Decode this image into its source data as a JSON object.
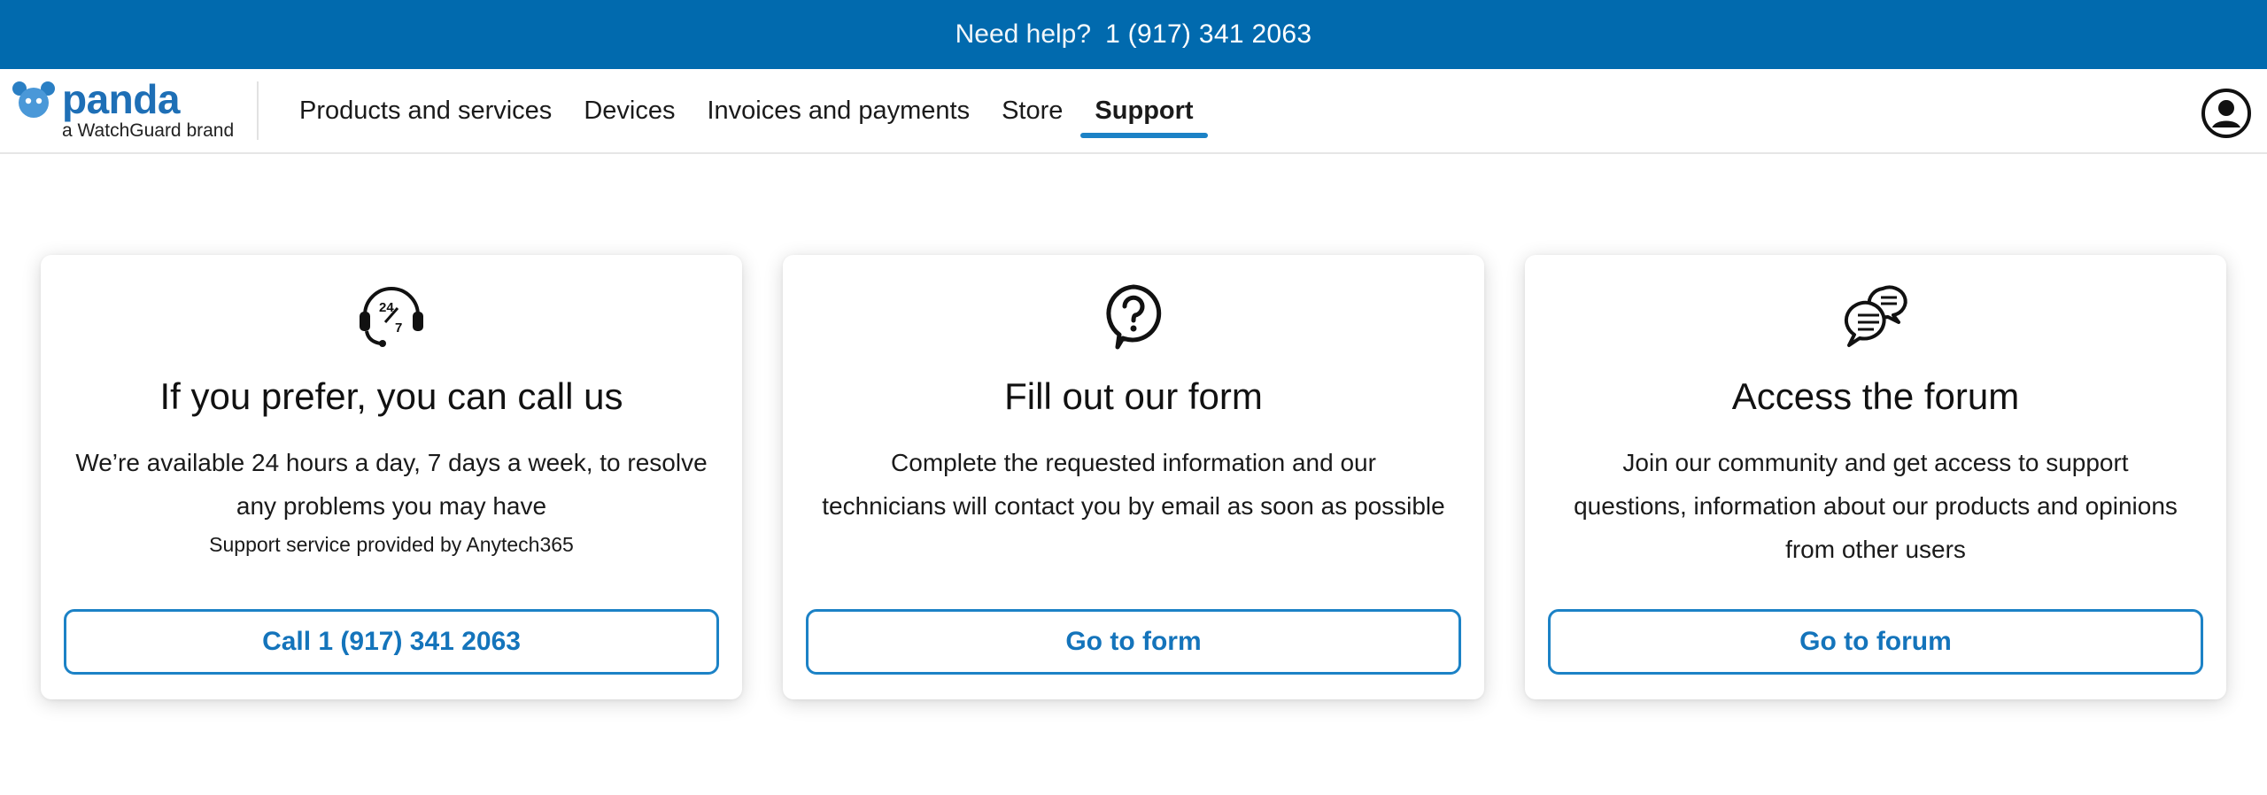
{
  "topbar": {
    "help_label": "Need help?",
    "phone": "1 (917) 341 2063",
    "background": "#016aae"
  },
  "brand": {
    "name": "panda",
    "tagline": "a WatchGuard brand",
    "color": "#1e6fb6"
  },
  "nav": {
    "items": [
      {
        "label": "Products and services",
        "active": false
      },
      {
        "label": "Devices",
        "active": false
      },
      {
        "label": "Invoices and payments",
        "active": false
      },
      {
        "label": "Store",
        "active": false
      },
      {
        "label": "Support",
        "active": true
      }
    ],
    "accent": "#1c82c6"
  },
  "account": {
    "icon": "account-circle-icon"
  },
  "cards": [
    {
      "icon": "headset-24-7-icon",
      "icon_text_top": "24",
      "icon_text_bottom": "7",
      "title": "If you prefer, you can call us",
      "text_line1": "We’re available 24 hours a day, 7 days a week, to resolve",
      "text_line2": "any problems you may have",
      "note": "Support service provided by Anytech365",
      "button": "Call 1 (917) 341 2063"
    },
    {
      "icon": "question-bubble-icon",
      "title": "Fill out our form",
      "text_line1": "Complete the requested information and our",
      "text_line2": "technicians will contact you by email as soon as possible",
      "button": "Go to form"
    },
    {
      "icon": "chat-bubbles-icon",
      "title": "Access the forum",
      "text_line1": "Join our community and get access to support",
      "text_line2": "questions, information about our products and opinions",
      "text_line3": "from other users",
      "button": "Go to forum"
    }
  ]
}
